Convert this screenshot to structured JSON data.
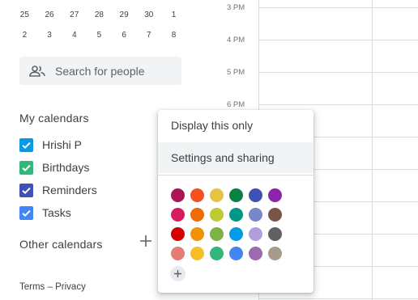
{
  "mini_calendar": {
    "row1": [
      "25",
      "26",
      "27",
      "28",
      "29",
      "30",
      "1"
    ],
    "row2": [
      "2",
      "3",
      "4",
      "5",
      "6",
      "7",
      "8"
    ]
  },
  "search": {
    "icon": "people-icon",
    "placeholder": "Search for people"
  },
  "my_calendars": {
    "title": "My calendars",
    "items": [
      {
        "label": "Hrishi P",
        "color": "#039be5",
        "checked": true
      },
      {
        "label": "Birthdays",
        "color": "#33b679",
        "checked": true
      },
      {
        "label": "Reminders",
        "color": "#3f51b5",
        "checked": true
      },
      {
        "label": "Tasks",
        "color": "#4285f4",
        "checked": true
      }
    ]
  },
  "other_calendars": {
    "title": "Other calendars",
    "add_icon": "plus-icon"
  },
  "footer": {
    "terms": "Terms",
    "separator": "–",
    "privacy": "Privacy"
  },
  "time_grid": {
    "labels": [
      "3 PM",
      "4 PM",
      "5 PM",
      "6 PM"
    ]
  },
  "context_menu": {
    "display_only": "Display this only",
    "settings_sharing": "Settings and sharing",
    "selected_color": "#4285f4",
    "colors": [
      [
        "#ad1457",
        "#f4511e",
        "#e4c441",
        "#0b8043",
        "#3f51b5",
        "#8e24aa"
      ],
      [
        "#d81b60",
        "#ef6c00",
        "#c0ca33",
        "#009688",
        "#7986cb",
        "#795548"
      ],
      [
        "#d50000",
        "#f09300",
        "#7cb342",
        "#039be5",
        "#b39ddb",
        "#616161"
      ],
      [
        "#e67c73",
        "#f6bf26",
        "#33b679",
        "#4285f4",
        "#9e69af",
        "#a79b8e"
      ]
    ],
    "add_color_icon": "plus-icon"
  }
}
